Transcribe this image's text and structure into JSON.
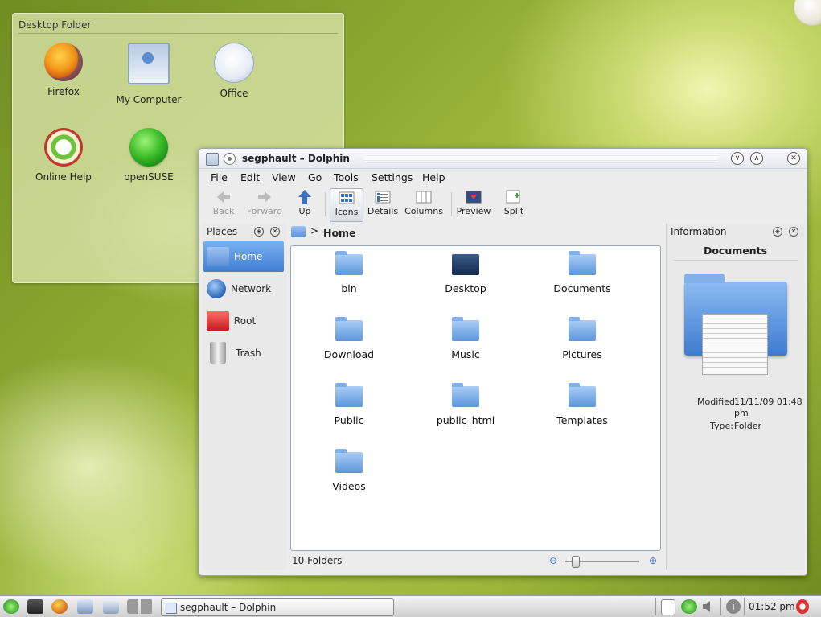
{
  "desktop_folder": {
    "title": "Desktop Folder",
    "icons": [
      {
        "label": "Firefox",
        "icon": "firefox-icon"
      },
      {
        "label": "My Computer",
        "icon": "computer-icon"
      },
      {
        "label": "Office",
        "icon": "office-icon"
      },
      {
        "label": "Online Help",
        "icon": "help-icon"
      },
      {
        "label": "openSUSE",
        "icon": "opensuse-icon"
      }
    ]
  },
  "window": {
    "title": "segphault – Dolphin",
    "menu": [
      "File",
      "Edit",
      "View",
      "Go",
      "Tools",
      "Settings",
      "Help"
    ],
    "toolbar": {
      "back": "Back",
      "forward": "Forward",
      "up": "Up",
      "icons": "Icons",
      "details": "Details",
      "columns": "Columns",
      "preview": "Preview",
      "split": "Split"
    },
    "places": {
      "title": "Places",
      "items": [
        {
          "label": "Home",
          "icon": "home-icon",
          "selected": true
        },
        {
          "label": "Network",
          "icon": "network-icon"
        },
        {
          "label": "Root",
          "icon": "root-folder-icon"
        },
        {
          "label": "Trash",
          "icon": "trash-icon"
        }
      ]
    },
    "breadcrumb": {
      "location": "Home"
    },
    "files": [
      "bin",
      "Desktop",
      "Documents",
      "Download",
      "Music",
      "Pictures",
      "Public",
      "public_html",
      "Templates",
      "Videos"
    ],
    "status": "10 Folders",
    "information": {
      "title": "Information",
      "name": "Documents",
      "modified_key": "Modified:",
      "modified_value": "11/11/09 01:48",
      "modified_value_2": "pm",
      "type_key": "Type:",
      "type_value": "Folder"
    }
  },
  "taskbar": {
    "task_title": "segphault – Dolphin",
    "clock": "01:52 pm"
  }
}
